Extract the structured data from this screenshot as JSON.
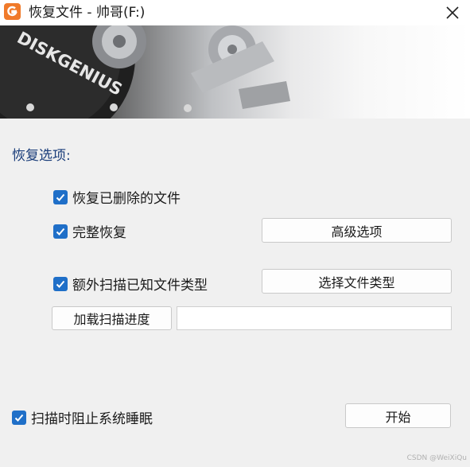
{
  "window": {
    "title": "恢复文件 - 帅哥(F:)",
    "app_icon": "diskgenius-icon",
    "close_icon": "close-icon"
  },
  "banner": {
    "brand_text": "DISKGENIUS",
    "accent": "#f07a2a"
  },
  "options": {
    "section_label": "恢复选项:",
    "recover_deleted": {
      "label": "恢复已删除的文件",
      "checked": true
    },
    "full_recovery": {
      "label": "完整恢复",
      "checked": true
    },
    "extra_scan": {
      "label": "额外扫描已知文件类型",
      "checked": true
    },
    "prevent_sleep": {
      "label": "扫描时阻止系统睡眠",
      "checked": true
    }
  },
  "buttons": {
    "advanced": "高级选项",
    "select_types": "选择文件类型",
    "load_progress": "加载扫描进度",
    "start": "开始"
  },
  "progress_input": {
    "value": ""
  },
  "watermark": "CSDN @WeiXiQu",
  "colors": {
    "checkbox": "#1f6fc8",
    "section_label": "#1a3d7a"
  }
}
